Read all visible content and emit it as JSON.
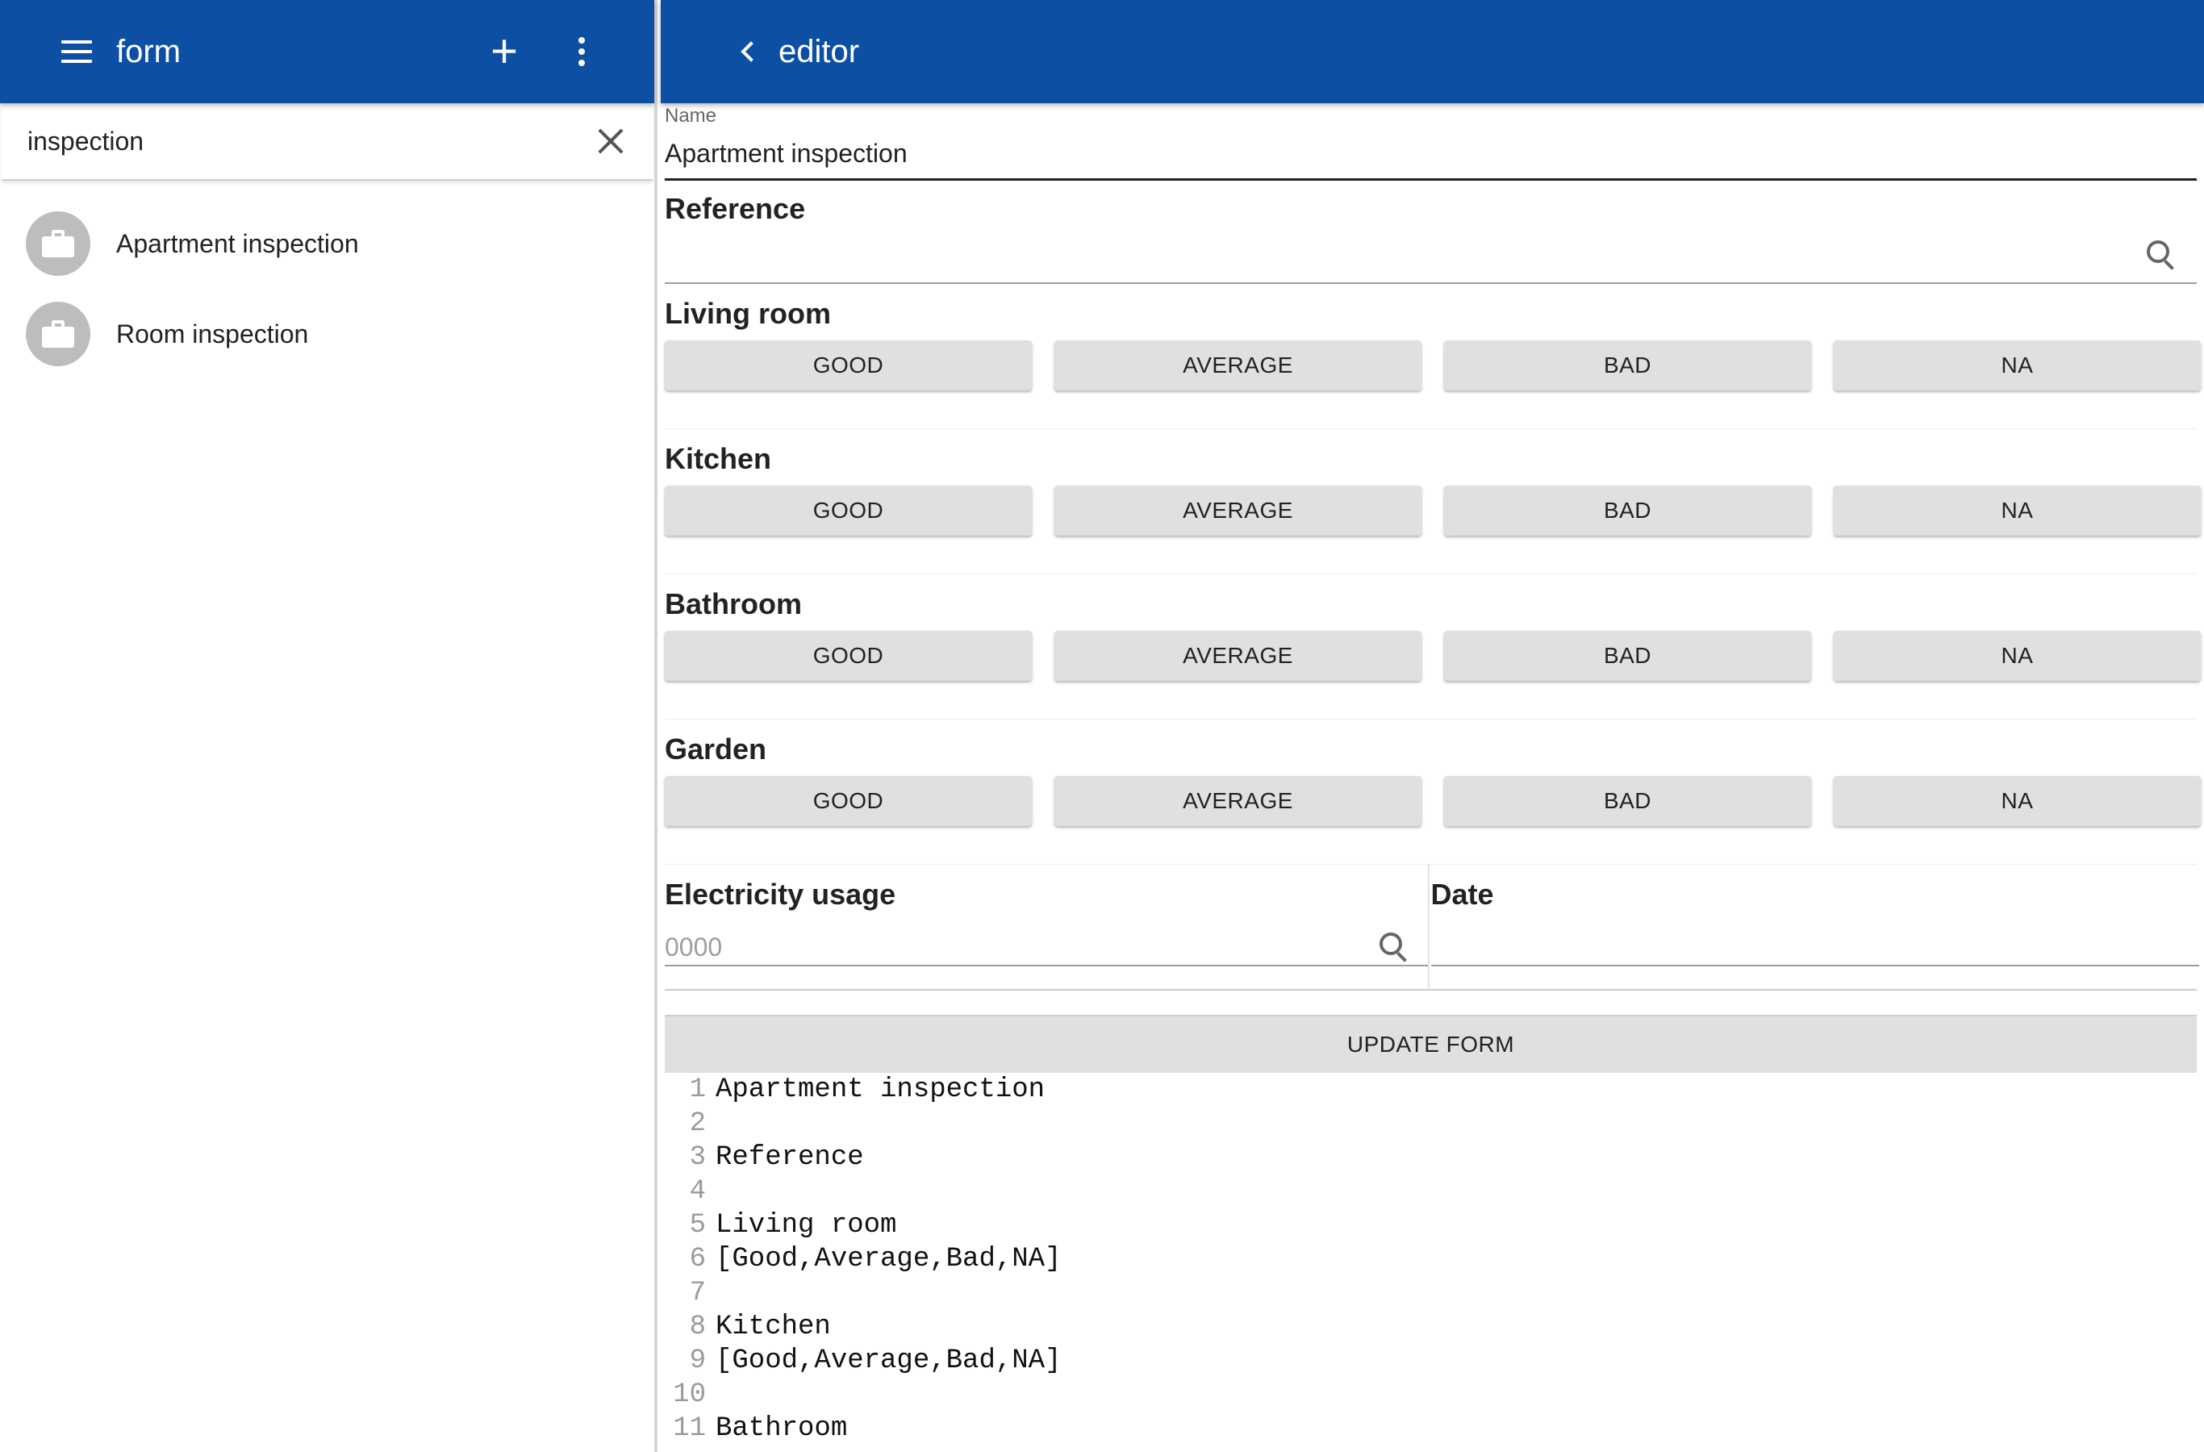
{
  "left": {
    "title": "form",
    "search_value": "inspection",
    "items": [
      {
        "label": "Apartment inspection"
      },
      {
        "label": "Room inspection"
      }
    ]
  },
  "right": {
    "title": "editor",
    "name_caption": "Name",
    "name_value": "Apartment inspection",
    "reference_label": "Reference",
    "sections": [
      {
        "label": "Living room",
        "options": [
          "GOOD",
          "AVERAGE",
          "BAD",
          "NA"
        ]
      },
      {
        "label": "Kitchen",
        "options": [
          "GOOD",
          "AVERAGE",
          "BAD",
          "NA"
        ]
      },
      {
        "label": "Bathroom",
        "options": [
          "GOOD",
          "AVERAGE",
          "BAD",
          "NA"
        ]
      },
      {
        "label": "Garden",
        "options": [
          "GOOD",
          "AVERAGE",
          "BAD",
          "NA"
        ]
      }
    ],
    "electricity_label": "Electricity usage",
    "electricity_placeholder": "0000",
    "date_label": "Date",
    "update_button": "UPDATE FORM",
    "code_lines": [
      {
        "n": "1",
        "t": "Apartment inspection"
      },
      {
        "n": "2",
        "t": ""
      },
      {
        "n": "3",
        "t": "Reference"
      },
      {
        "n": "4",
        "t": ""
      },
      {
        "n": "5",
        "t": "Living room"
      },
      {
        "n": "6",
        "t": "[Good,Average,Bad,NA]"
      },
      {
        "n": "7",
        "t": ""
      },
      {
        "n": "8",
        "t": "Kitchen"
      },
      {
        "n": "9",
        "t": "[Good,Average,Bad,NA]"
      },
      {
        "n": "10",
        "t": ""
      },
      {
        "n": "11",
        "t": "Bathroom"
      }
    ]
  },
  "colors": {
    "app_bar": "#0d50a3",
    "button_bg": "#e0e0e0",
    "avatar_bg": "#bdbdbd"
  },
  "icons": {
    "left_bar": [
      "menu-icon",
      "plus-icon",
      "more-vert-icon"
    ],
    "search": "close-icon",
    "list_item": "briefcase-icon",
    "right_bar": "chevron-left-icon",
    "fields": "search-icon"
  }
}
